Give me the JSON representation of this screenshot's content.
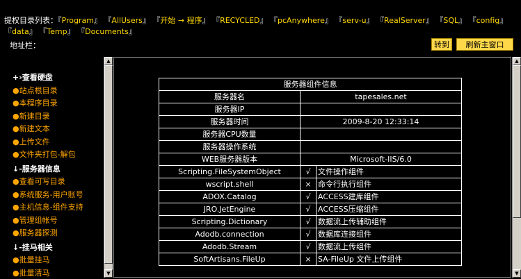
{
  "nav": {
    "label": "提权目录列表：",
    "links": [
      "Program",
      "AllUsers",
      "开始 → 程序",
      "RECYCLED",
      "pcAnywhere",
      "serv-u",
      "RealServer",
      "SQL",
      "config",
      "data",
      "Temp",
      "Documents"
    ],
    "open_bracket": "『",
    "close_bracket": "』"
  },
  "address": {
    "label": "地址栏：",
    "value": "",
    "goto_label": "转到",
    "refresh_label": "刷新主窗口"
  },
  "sidebar": {
    "sections": [
      {
        "head": "+›查看硬盘",
        "items": [
          "站点根目录",
          "本程序目录",
          "新建目录",
          "新建文本",
          "上传文件",
          "文件夹打包-解包"
        ]
      },
      {
        "head": "↓-服务器信息",
        "items": [
          "查看可写目录",
          "系统服务-用户账号",
          "主机信息-组件支持",
          "管理组帐号",
          "服务器探测"
        ]
      },
      {
        "head": "↓-挂马相关",
        "items": [
          "批量挂马",
          "批量清马"
        ]
      }
    ]
  },
  "info": {
    "title": "服务器组件信息",
    "server_rows": [
      {
        "name": "服务器名",
        "value": "tapesales.net"
      },
      {
        "name": "服务器IP",
        "value": ""
      },
      {
        "name": "服务器时间",
        "value": "2009-8-20 12:33:14"
      },
      {
        "name": "服务器CPU数量",
        "value": ""
      },
      {
        "name": "服务器操作系统",
        "value": ""
      },
      {
        "name": "WEB服务器版本",
        "value": "Microsoft-IIS/6.0"
      }
    ],
    "component_rows": [
      {
        "name": "Scripting.FileSystemObject",
        "mark": "√",
        "desc": "文件操作组件"
      },
      {
        "name": "wscript.shell",
        "mark": "×",
        "desc": "命令行执行组件"
      },
      {
        "name": "ADOX.Catalog",
        "mark": "√",
        "desc": "ACCESS建库组件"
      },
      {
        "name": "JRO.JetEngine",
        "mark": "√",
        "desc": "ACCESS压缩组件"
      },
      {
        "name": "Scripting.Dictionary",
        "mark": "√",
        "desc": "数据流上传辅助组件"
      },
      {
        "name": "Adodb.connection",
        "mark": "√",
        "desc": "数据库连接组件"
      },
      {
        "name": "Adodb.Stream",
        "mark": "√",
        "desc": "数据流上传组件"
      },
      {
        "name": "SoftArtisans.FileUp",
        "mark": "×",
        "desc": "SA-FileUp 文件上传组件"
      }
    ]
  },
  "colors": {
    "link": "#ffd700",
    "sidebar_item": "#ffa500",
    "button": "#ffd84a"
  }
}
